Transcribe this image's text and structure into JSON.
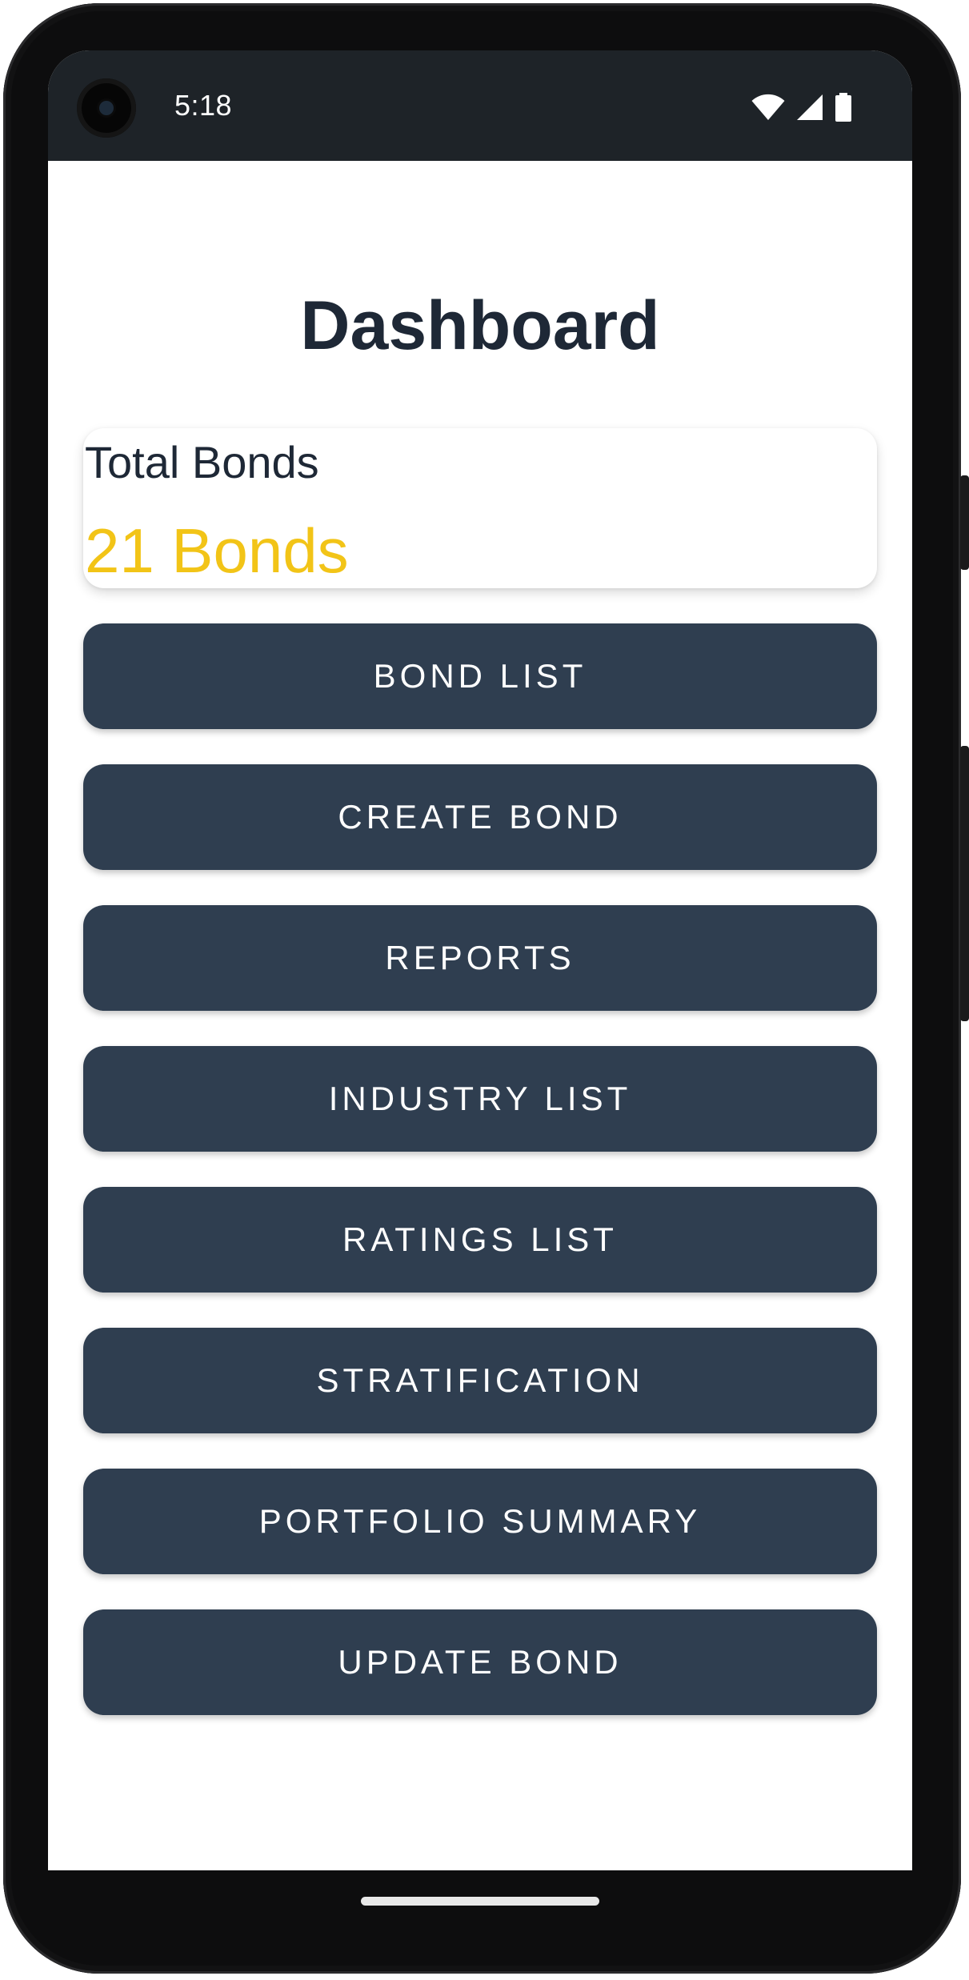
{
  "status_bar": {
    "time": "5:18",
    "icons": [
      "camera-icon",
      "wifi-icon",
      "cellular-signal-icon",
      "battery-icon"
    ]
  },
  "page": {
    "title": "Dashboard"
  },
  "summary": {
    "label": "Total Bonds",
    "value": "21 Bonds"
  },
  "menu": {
    "items": [
      {
        "label": "BOND LIST"
      },
      {
        "label": "CREATE BOND"
      },
      {
        "label": "REPORTS"
      },
      {
        "label": "INDUSTRY LIST"
      },
      {
        "label": "RATINGS LIST"
      },
      {
        "label": "STRATIFICATION"
      },
      {
        "label": "PORTFOLIO SUMMARY"
      },
      {
        "label": "UPDATE BOND"
      }
    ]
  },
  "colors": {
    "status_bar_bg": "#1e2328",
    "title_text": "#1e2836",
    "accent_value": "#f2c417",
    "button_bg": "#2f3e50",
    "button_text": "#ffffff"
  }
}
